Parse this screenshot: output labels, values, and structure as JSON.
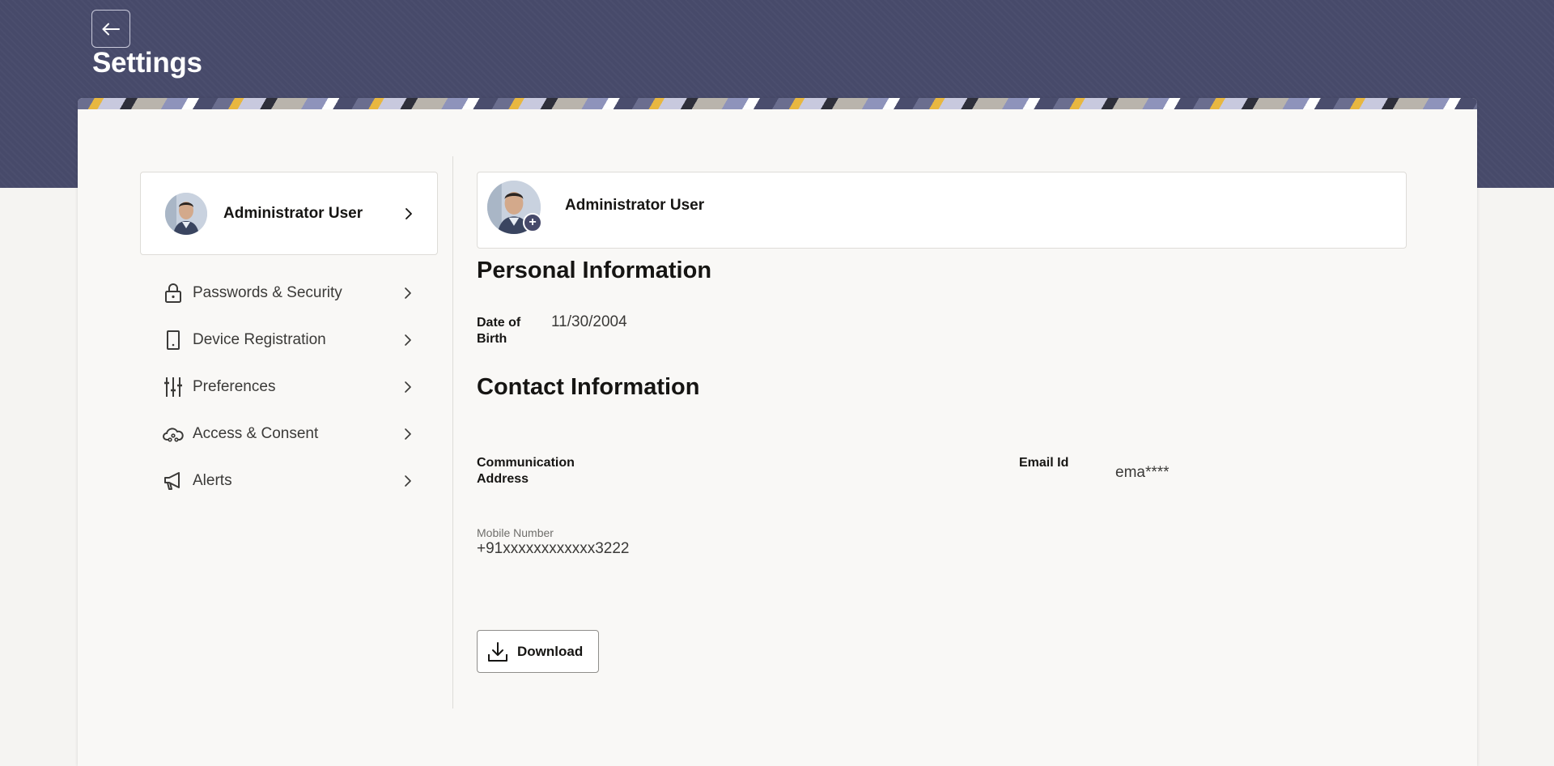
{
  "page": {
    "title": "Settings",
    "back_icon": "arrow-left-icon"
  },
  "sidebar": {
    "profile": {
      "name": "Administrator User",
      "avatar_icon": "user-avatar"
    },
    "items": [
      {
        "label": "Passwords & Security",
        "icon": "lock-icon"
      },
      {
        "label": "Device Registration",
        "icon": "mobile-device-icon"
      },
      {
        "label": "Preferences",
        "icon": "sliders-icon"
      },
      {
        "label": "Access & Consent",
        "icon": "cloud-share-icon"
      },
      {
        "label": "Alerts",
        "icon": "megaphone-icon"
      }
    ]
  },
  "profile_header": {
    "name": "Administrator User",
    "add_photo_symbol": "+"
  },
  "personal_info": {
    "heading": "Personal Information",
    "dob_label_line1": "Date of",
    "dob_label_line2": "Birth",
    "dob_value": "11/30/2004"
  },
  "contact_info": {
    "heading": "Contact Information",
    "address_label_line1": "Communication",
    "address_label_line2": "Address",
    "email_label": "Email Id",
    "email_value": "ema****",
    "mobile_label": "Mobile Number",
    "mobile_value": "+91xxxxxxxxxxxx3222"
  },
  "actions": {
    "download_label": "Download"
  },
  "colors": {
    "header_band": "#474a6a",
    "card_bg": "#f9f8f6",
    "text_primary": "#161513"
  }
}
